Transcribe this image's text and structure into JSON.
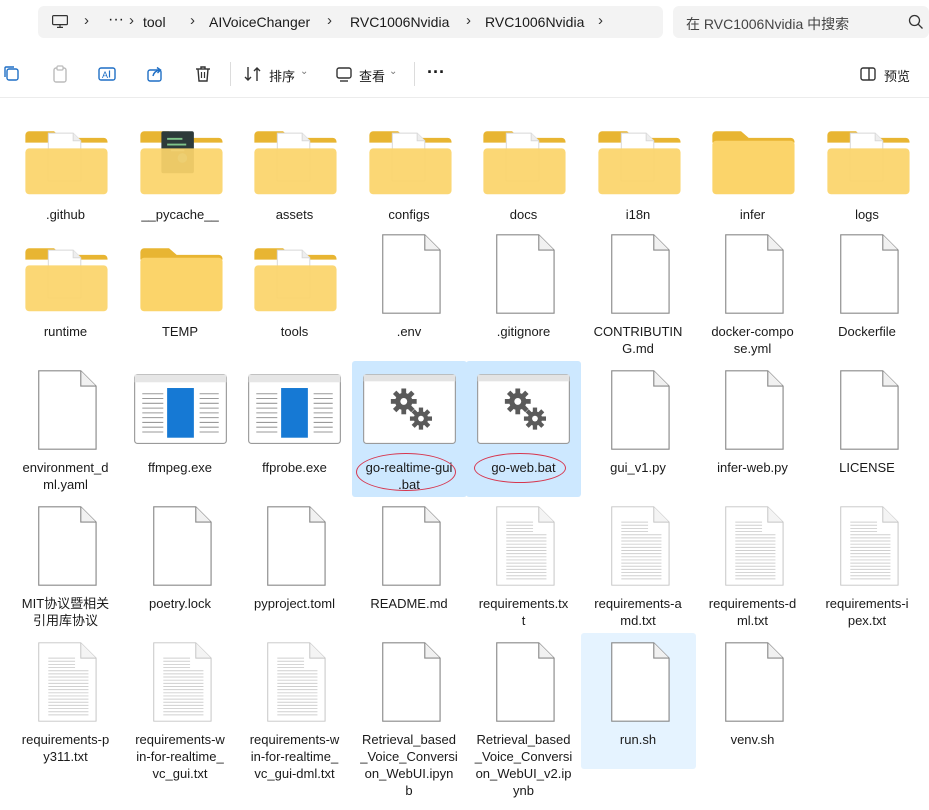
{
  "address": {
    "crumbs": [
      "···",
      "tool",
      "AIVoiceChanger",
      "RVC1006Nvidia",
      "RVC1006Nvidia"
    ],
    "search_placeholder": "在 RVC1006Nvidia 中搜索"
  },
  "toolbar": {
    "sort_label": "排序",
    "view_label": "查看",
    "more_label": "···",
    "preview_label": "预览"
  },
  "files": [
    {
      "name": ".github",
      "kind": "folder-doc"
    },
    {
      "name": "__pycache__",
      "kind": "folder-code"
    },
    {
      "name": "assets",
      "kind": "folder-doc"
    },
    {
      "name": "configs",
      "kind": "folder-doc"
    },
    {
      "name": "docs",
      "kind": "folder-doc"
    },
    {
      "name": "i18n",
      "kind": "folder-doc"
    },
    {
      "name": "infer",
      "kind": "folder"
    },
    {
      "name": "logs",
      "kind": "folder-doc"
    },
    {
      "name": "runtime",
      "kind": "folder-doc"
    },
    {
      "name": "TEMP",
      "kind": "folder"
    },
    {
      "name": "tools",
      "kind": "folder-doc"
    },
    {
      "name": ".env",
      "kind": "file"
    },
    {
      "name": ".gitignore",
      "kind": "file"
    },
    {
      "name": "CONTRIBUTING.md",
      "kind": "file",
      "display": "CONTRIBUTIN\nG.md"
    },
    {
      "name": "docker-compose.yml",
      "kind": "file",
      "display": "docker-compo\nse.yml"
    },
    {
      "name": "Dockerfile",
      "kind": "file"
    },
    {
      "name": "environment_dml.yaml",
      "kind": "file",
      "display": "environment_d\nml.yaml"
    },
    {
      "name": "ffmpeg.exe",
      "kind": "exe"
    },
    {
      "name": "ffprobe.exe",
      "kind": "exe"
    },
    {
      "name": "go-realtime-gui.bat",
      "kind": "bat",
      "display": "go-realtime-gui\n.bat",
      "state": "selected"
    },
    {
      "name": "go-web.bat",
      "kind": "bat",
      "state": "selected"
    },
    {
      "name": "gui_v1.py",
      "kind": "file"
    },
    {
      "name": "infer-web.py",
      "kind": "file"
    },
    {
      "name": "LICENSE",
      "kind": "file"
    },
    {
      "name": "MIT协议暨相关引用库协议",
      "kind": "file",
      "display": "MIT协议暨相关\n引用库协议"
    },
    {
      "name": "poetry.lock",
      "kind": "file"
    },
    {
      "name": "pyproject.toml",
      "kind": "file"
    },
    {
      "name": "README.md",
      "kind": "file"
    },
    {
      "name": "requirements.txt",
      "kind": "text",
      "display": "requirements.tx\nt"
    },
    {
      "name": "requirements-amd.txt",
      "kind": "text",
      "display": "requirements-a\nmd.txt"
    },
    {
      "name": "requirements-dml.txt",
      "kind": "text",
      "display": "requirements-d\nml.txt"
    },
    {
      "name": "requirements-ipex.txt",
      "kind": "text",
      "display": "requirements-i\npex.txt"
    },
    {
      "name": "requirements-py311.txt",
      "kind": "text",
      "display": "requirements-p\ny311.txt"
    },
    {
      "name": "requirements-win-for-realtime_vc_gui.txt",
      "kind": "text",
      "display": "requirements-w\nin-for-realtime_\nvc_gui.txt"
    },
    {
      "name": "requirements-win-for-realtime_vc_gui-dml.txt",
      "kind": "text",
      "display": "requirements-w\nin-for-realtime_\nvc_gui-dml.txt"
    },
    {
      "name": "Retrieval_based_Voice_Conversion_WebUI.ipynb",
      "kind": "file",
      "display": "Retrieval_based\n_Voice_Conversi\non_WebUI.ipyn\nb"
    },
    {
      "name": "Retrieval_based_Voice_Conversion_WebUI_v2.ipynb",
      "kind": "file",
      "display": "Retrieval_based\n_Voice_Conversi\non_WebUI_v2.ip\nynb"
    },
    {
      "name": "run.sh",
      "kind": "file",
      "state": "hover"
    },
    {
      "name": "venv.sh",
      "kind": "file"
    }
  ],
  "colors": {
    "folder_back": "#e8b532",
    "folder_front": "#fbd46a",
    "selection": "#cde8ff",
    "hover": "#e5f3ff",
    "annotation": "#d6374f",
    "exe_blue": "#1679d4",
    "gear": "#5a5a5a"
  }
}
